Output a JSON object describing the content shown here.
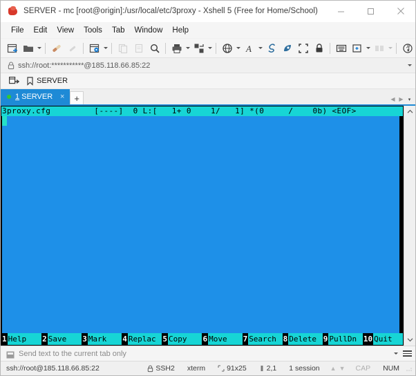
{
  "window": {
    "title": "SERVER - mc [root@origin]:/usr/local/etc/3proxy - Xshell 5 (Free for Home/School)",
    "app_icon": "xshell-icon",
    "minimize_label": "Minimize",
    "maximize_label": "Maximize",
    "close_label": "Close"
  },
  "menubar": {
    "items": [
      {
        "label": "File",
        "name": "menu-file"
      },
      {
        "label": "Edit",
        "name": "menu-edit"
      },
      {
        "label": "View",
        "name": "menu-view"
      },
      {
        "label": "Tools",
        "name": "menu-tools"
      },
      {
        "label": "Tab",
        "name": "menu-tab"
      },
      {
        "label": "Window",
        "name": "menu-window"
      },
      {
        "label": "Help",
        "name": "menu-help"
      }
    ]
  },
  "toolbar": {
    "overflow_label": "»",
    "items": [
      {
        "name": "new-session-icon",
        "caret": false,
        "disabled": false
      },
      {
        "name": "open-folder-icon",
        "caret": true,
        "disabled": false
      },
      {
        "name": "connect-icon",
        "caret": false,
        "disabled": false
      },
      {
        "name": "disconnect-icon",
        "caret": false,
        "disabled": true
      },
      {
        "name": "properties-icon",
        "caret": true,
        "disabled": false
      },
      {
        "name": "copy-icon",
        "caret": false,
        "disabled": true
      },
      {
        "name": "paste-icon",
        "caret": false,
        "disabled": true
      },
      {
        "name": "find-icon",
        "caret": false,
        "disabled": false
      },
      {
        "name": "print-icon",
        "caret": true,
        "disabled": false
      },
      {
        "name": "transfer-icon",
        "caret": true,
        "disabled": false
      },
      {
        "name": "globe-icon",
        "caret": true,
        "disabled": false
      },
      {
        "name": "font-icon",
        "caret": true,
        "disabled": false
      },
      {
        "name": "clear-screen-icon",
        "caret": false,
        "disabled": false
      },
      {
        "name": "compose-bar-icon",
        "caret": false,
        "disabled": false
      },
      {
        "name": "fullscreen-icon",
        "caret": false,
        "disabled": false
      },
      {
        "name": "lock-icon",
        "caret": false,
        "disabled": false
      },
      {
        "name": "keyboard-icon",
        "caret": false,
        "disabled": false
      },
      {
        "name": "add-tab-icon",
        "caret": true,
        "disabled": false
      },
      {
        "name": "arrange-icon",
        "caret": true,
        "disabled": true
      },
      {
        "name": "help-icon",
        "caret": false,
        "disabled": false
      }
    ]
  },
  "address_bar": {
    "icon": "lock-icon",
    "value": "ssh://root:***********@185.118.66.85:22",
    "dropdown_label": "History"
  },
  "bookmark_bar": {
    "open_icon": "open-session-icon",
    "items": [
      {
        "icon": "bookmark-icon",
        "label": "SERVER"
      }
    ]
  },
  "tabs": {
    "items": [
      {
        "status": "connected",
        "number": "1",
        "label": "SERVER",
        "close": "×"
      }
    ],
    "new_tab_label": "+",
    "nav_prev": "◀",
    "nav_next": "▶",
    "nav_list": "▾"
  },
  "terminal": {
    "mc_header": "3proxy.cfg         [----]  0 L:[   1+ 0    1/   1] *(0     /    0b) <EOF>",
    "background": "#1e90e8",
    "header_background": "#17d5d5",
    "cursor_color": "#25e0c8",
    "function_keys": [
      {
        "num": "1",
        "label": "Help"
      },
      {
        "num": "2",
        "label": "Save"
      },
      {
        "num": "3",
        "label": "Mark"
      },
      {
        "num": "4",
        "label": "Replac"
      },
      {
        "num": "5",
        "label": "Copy"
      },
      {
        "num": "6",
        "label": "Move"
      },
      {
        "num": "7",
        "label": "Search"
      },
      {
        "num": "8",
        "label": "Delete"
      },
      {
        "num": "9",
        "label": "PullDn"
      },
      {
        "num": "10",
        "label": "Quit"
      }
    ]
  },
  "scrollbar": {
    "up_label": "∧",
    "down_label": "∨"
  },
  "send_bar": {
    "icon": "send-text-icon",
    "label": "Send text to the current tab only",
    "menu_label": "Options"
  },
  "status_bar": {
    "connection": "ssh://root@185.118.66.85:22",
    "protocol": "SSH2",
    "terminal_type": "xterm",
    "size": "91x25",
    "cursor_position": "2,1",
    "sessions": "1 session",
    "caps": "CAP",
    "num": "NUM"
  }
}
